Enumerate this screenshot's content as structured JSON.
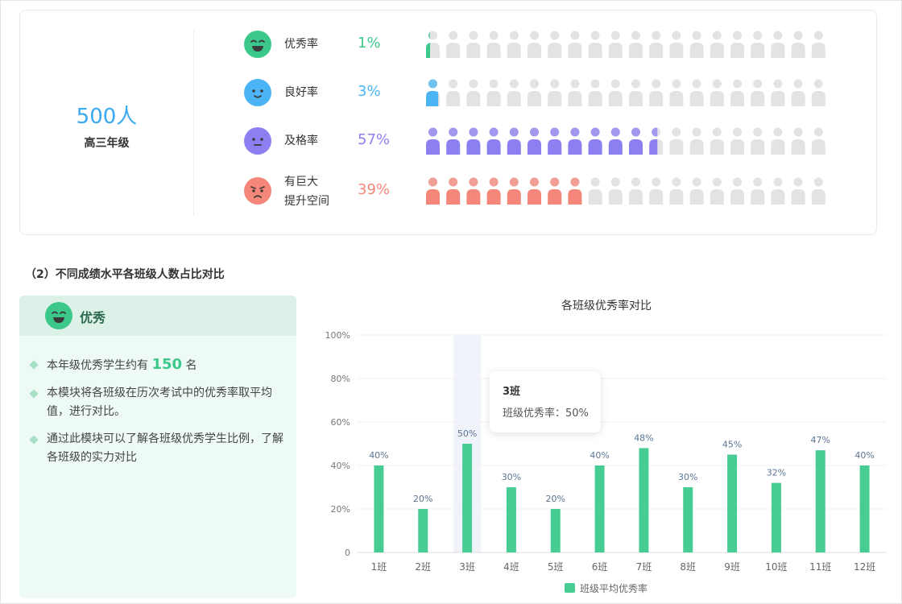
{
  "summary": {
    "total_count": "500人",
    "grade": "高三年级"
  },
  "levels": [
    {
      "label_lines": [
        "优秀率"
      ],
      "percent_text": "1%",
      "value": 1,
      "color": "#3cc88a",
      "face": "grin"
    },
    {
      "label_lines": [
        "良好率"
      ],
      "percent_text": "3%",
      "value": 3,
      "color": "#4bb4f5",
      "face": "smile"
    },
    {
      "label_lines": [
        "及格率"
      ],
      "percent_text": "57%",
      "value": 57,
      "color": "#8c7ff2",
      "face": "neutral"
    },
    {
      "label_lines": [
        "有巨大",
        "提升空间"
      ],
      "percent_text": "39%",
      "value": 39,
      "color": "#f5877a",
      "face": "sad"
    }
  ],
  "person_count": 20,
  "section_title": "（2）不同成绩水平各班级人数占比对比",
  "info_card": {
    "title": "优秀",
    "bullets": [
      {
        "before": "本年级优秀学生约有 ",
        "highlight": "150",
        "after": " 名"
      },
      {
        "before": "本模块将各班级在历次考试中的优秀率取平均值，进行对比。",
        "highlight": "",
        "after": ""
      },
      {
        "before": "通过此模块可以了解各班级优秀学生比例，了解各班级的实力对比",
        "highlight": "",
        "after": ""
      }
    ]
  },
  "chart_data": {
    "type": "bar",
    "title": "各班级优秀率对比",
    "categories": [
      "1班",
      "2班",
      "3班",
      "4班",
      "5班",
      "6班",
      "7班",
      "8班",
      "9班",
      "10班",
      "11班",
      "12班"
    ],
    "series": [
      {
        "name": "班级平均优秀率",
        "values": [
          40,
          20,
          50,
          30,
          20,
          40,
          48,
          30,
          45,
          32,
          47,
          40
        ],
        "color": "#47cc93"
      }
    ],
    "data_labels": [
      "40%",
      "20%",
      "50%",
      "30%",
      "20%",
      "40%",
      "48%",
      "30%",
      "45%",
      "32%",
      "47%",
      "40%"
    ],
    "y_ticks": [
      "0",
      "20%",
      "40%",
      "60%",
      "80%",
      "100%"
    ],
    "ylim": [
      0,
      100
    ],
    "grid": true,
    "legend_position": "bottom",
    "highlighted_category": "3班",
    "tooltip": {
      "title": "3班",
      "label": "班级优秀率：",
      "value": "50%"
    }
  }
}
